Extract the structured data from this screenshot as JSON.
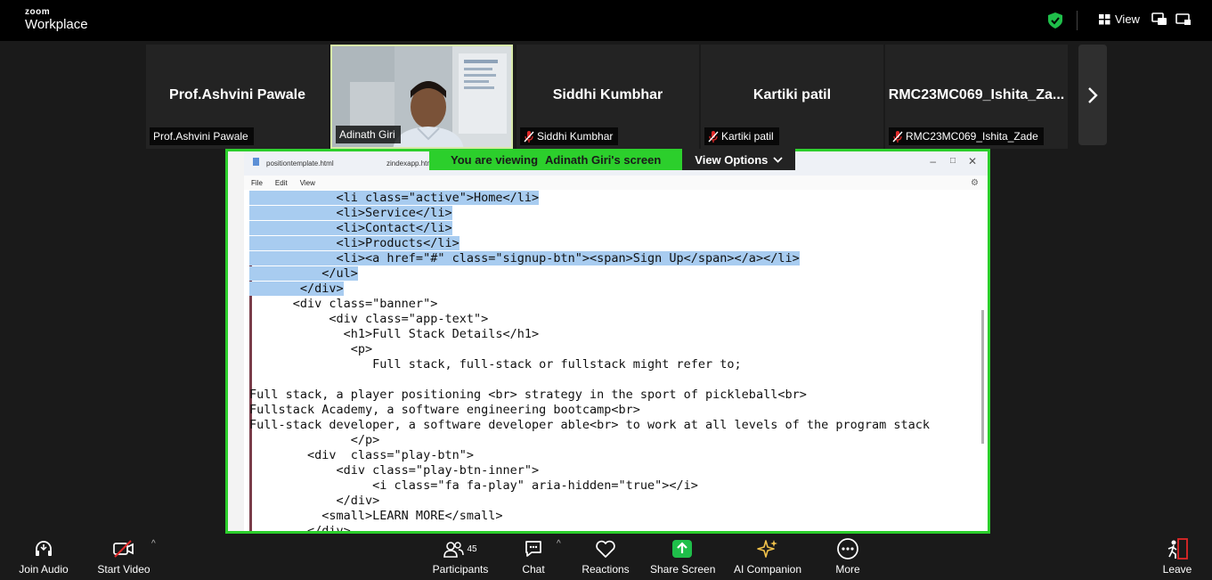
{
  "app": {
    "brand_top": "zoom",
    "brand_name": "Workplace"
  },
  "topbar": {
    "view_label": "View"
  },
  "participants_strip": [
    {
      "name": "Prof.Ashvini Pawale",
      "label": "Prof.Ashvini Pawale",
      "muted": false
    },
    {
      "name": "Adinath Giri",
      "label": "Adinath Giri",
      "muted": false,
      "video": true
    },
    {
      "name": "Siddhi Kumbhar",
      "label": "Siddhi Kumbhar",
      "muted": true
    },
    {
      "name": "Kartiki patil",
      "label": "Kartiki patil",
      "muted": true
    },
    {
      "name": "RMC23MC069_Ishita_Za...",
      "label": "RMC23MC069_Ishita_Zade",
      "muted": true
    }
  ],
  "share_banner": {
    "prefix": "You are viewing",
    "presenter": "Adinath Giri's screen",
    "view_options": "View Options"
  },
  "editor": {
    "tabs": [
      "positiontemplate.html",
      "zindexapp.html"
    ],
    "menu": [
      "File",
      "Edit",
      "View"
    ],
    "lines": [
      {
        "text": "            <li class=\"active\">Home</li>",
        "hl": true
      },
      {
        "text": "            <li>Service</li>",
        "hl": true
      },
      {
        "text": "            <li>Contact</li>",
        "hl": true
      },
      {
        "text": "            <li>Products</li>",
        "hl": true
      },
      {
        "text": "            <li><a href=\"#\" class=\"signup-btn\"><span>Sign Up</span></a></li>",
        "hl": true
      },
      {
        "text": "          </ul>",
        "hl": true
      },
      {
        "text": "       </div>",
        "hl": true
      },
      {
        "text": "      <div class=\"banner\">",
        "hl": false
      },
      {
        "text": "           <div class=\"app-text\">",
        "hl": false
      },
      {
        "text": "             <h1>Full Stack Details</h1>",
        "hl": false
      },
      {
        "text": "              <p>",
        "hl": false
      },
      {
        "text": "                 Full stack, full-stack or fullstack might refer to;",
        "hl": false
      },
      {
        "text": "",
        "hl": false
      },
      {
        "text": "Full stack, a player positioning <br> strategy in the sport of pickleball<br>",
        "hl": false
      },
      {
        "text": "Fullstack Academy, a software engineering bootcamp<br>",
        "hl": false
      },
      {
        "text": "Full-stack developer, a software developer able<br> to work at all levels of the program stack",
        "hl": false
      },
      {
        "text": "              </p>",
        "hl": false
      },
      {
        "text": "        <div  class=\"play-btn\">",
        "hl": false
      },
      {
        "text": "            <div class=\"play-btn-inner\">",
        "hl": false
      },
      {
        "text": "                 <i class=\"fa fa-play\" aria-hidden=\"true\"></i>",
        "hl": false
      },
      {
        "text": "            </div>",
        "hl": false
      },
      {
        "text": "          <small>LEARN MORE</small>",
        "hl": false
      },
      {
        "text": "        </div>",
        "hl": false
      }
    ]
  },
  "toolbar": {
    "join_audio": "Join Audio",
    "start_video": "Start Video",
    "participants": "Participants",
    "participants_count": "45",
    "chat": "Chat",
    "reactions": "Reactions",
    "share_screen": "Share Screen",
    "ai_companion": "AI Companion",
    "more": "More",
    "leave": "Leave"
  },
  "colors": {
    "share_green": "#2ccf2c",
    "leave_red": "#e02828",
    "shield_green": "#1fbf4a"
  }
}
